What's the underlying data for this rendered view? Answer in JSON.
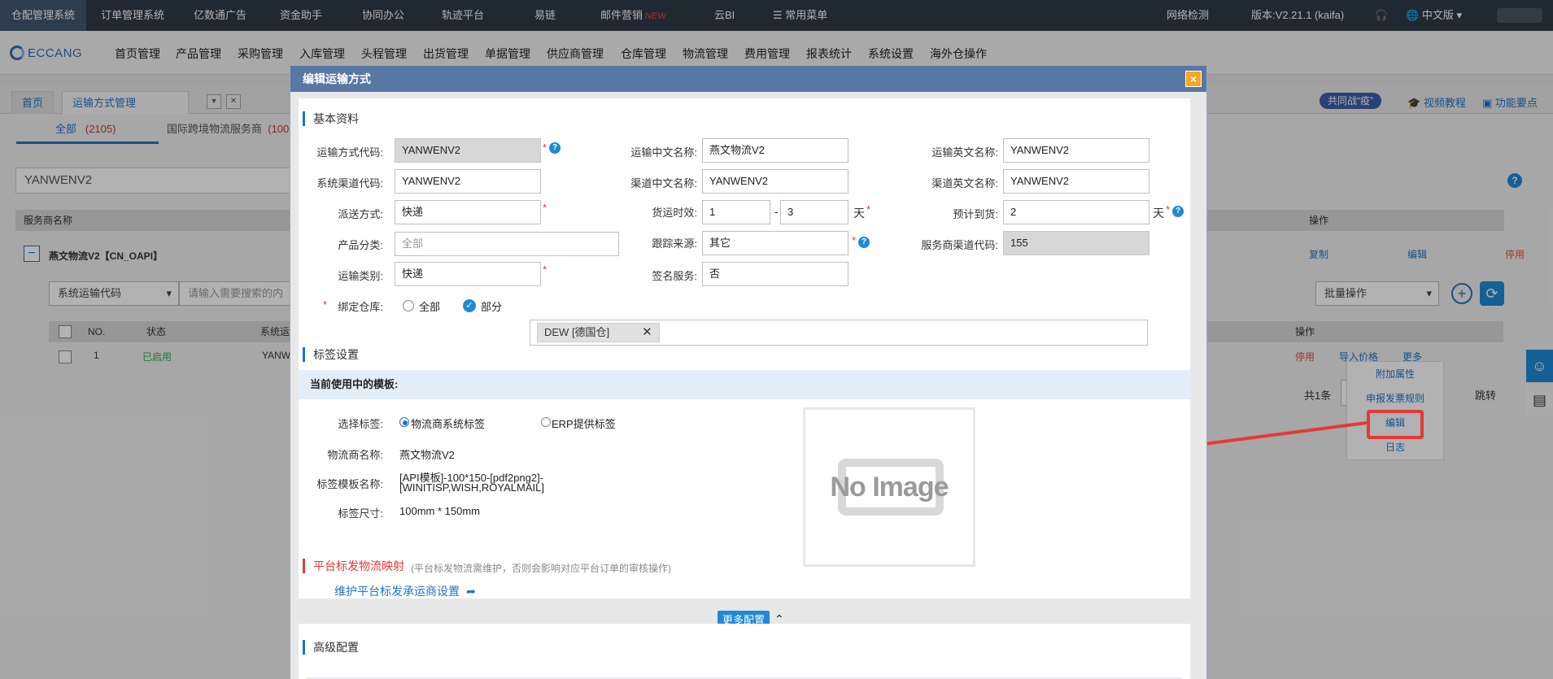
{
  "topbar": {
    "items": [
      "仓配管理系统",
      "订单管理系统",
      "亿数通广告",
      "资金助手",
      "协同办公",
      "轨迹平台",
      "易链",
      "邮件营销",
      "云BI",
      "常用菜单"
    ],
    "new_badge": "NEW",
    "network": "网络检测",
    "version": "版本:V2.21.1 (kaifa)",
    "language": "中文版"
  },
  "nav2": {
    "logo": "ECCANG",
    "items": [
      "首页管理",
      "产品管理",
      "采购管理",
      "入库管理",
      "头程管理",
      "出货管理",
      "单据管理",
      "供应商管理",
      "仓库管理",
      "物流管理",
      "费用管理",
      "报表统计",
      "系统设置",
      "海外仓操作"
    ]
  },
  "tabs": {
    "home": "首页",
    "active": "运输方式管理(NEW)",
    "close": "×",
    "right_badge": "共同战“疫”",
    "video": "视频教程",
    "feature": "功能要点"
  },
  "bg": {
    "subtab_all": "全部",
    "subtab_all_count": "(2105)",
    "subtab_intl": "国际跨境物流服务商",
    "subtab_intl_count": "(100",
    "search_value": "YANWENV2",
    "header_provider": "服务商名称",
    "header_op": "操作",
    "provider_row": "燕文物流V2【CN_OAPI】",
    "copy": "复制",
    "edit": "编辑",
    "disable": "停用",
    "select_code": "系统运输代码",
    "search_ph": "请输入需要搜索的内",
    "batch": "批量操作",
    "col_no": "NO.",
    "col_status": "状态",
    "col_sys": "系统运",
    "col_op": "操作",
    "row_no": "1",
    "row_status": "已启用",
    "row_code": "YANW",
    "row_disable": "停用",
    "row_import": "导入价格",
    "row_more": "更多",
    "total": "共1条",
    "jump": "跳转",
    "menu": [
      "附加属性",
      "申报发票规则",
      "编辑",
      "日志"
    ]
  },
  "modal": {
    "title": "编辑运输方式",
    "close": "×",
    "sec_basic": "基本资料",
    "f_code_l": "运输方式代码:",
    "f_code": "YANWENV2",
    "f_cn_l": "运输中文名称:",
    "f_cn": "燕文物流V2",
    "f_en_l": "运输英文名称:",
    "f_en": "YANWENV2",
    "f_syscode_l": "系统渠道代码:",
    "f_syscode": "YANWENV2",
    "f_chcn_l": "渠道中文名称:",
    "f_chcn": "YANWENV2",
    "f_chen_l": "渠道英文名称:",
    "f_chen": "YANWENV2",
    "f_delivery_l": "派送方式:",
    "f_delivery": "快递",
    "f_aging_l": "货运时效:",
    "f_aging_from": "1",
    "f_aging_to": "3",
    "dash": "-",
    "day": "天",
    "f_eta_l": "预计到货:",
    "f_eta": "2",
    "f_cat_l": "产品分类:",
    "f_cat_ph": "全部",
    "f_track_l": "跟踪来源:",
    "f_track": "其它",
    "f_svc_l": "服务商渠道代码:",
    "f_svc": "155",
    "f_type_l": "运输类别:",
    "f_type": "快递",
    "f_sign_l": "签名服务:",
    "f_sign": "否",
    "f_wh_l": "绑定仓库:",
    "wh_all": "全部",
    "wh_part": "部分",
    "wh_tag": "DEW [德国仓]",
    "sec_label": "标签设置",
    "cur_tpl": "当前使用中的模板:",
    "sel_label_l": "选择标签:",
    "opt_carrier": "物流商系统标签",
    "opt_erp": "ERP提供标签",
    "carrier_name_l": "物流商名称:",
    "carrier_name": "燕文物流V2",
    "tpl_name_l": "标签模板名称:",
    "tpl_name_1": "[API模板]-100*150-[pdf2png2]-",
    "tpl_name_2": "[WINITISP,WISH,ROYALMAIL]",
    "size_l": "标签尺寸:",
    "size": "100mm * 150mm",
    "no_image": "No Image",
    "sec_platform": "平台标发物流映射",
    "platform_note": "(平台标发物流需维护，否则会影响对应平台订单的审核操作)",
    "platform_link": "维护平台标发承运商设置",
    "more_cfg": "更多配置",
    "sec_adv": "高级配置"
  },
  "colors": {
    "accent": "#1f73c9",
    "title_bar": "#5877a3",
    "danger": "#e53935",
    "topbar": "#2f3a48"
  }
}
